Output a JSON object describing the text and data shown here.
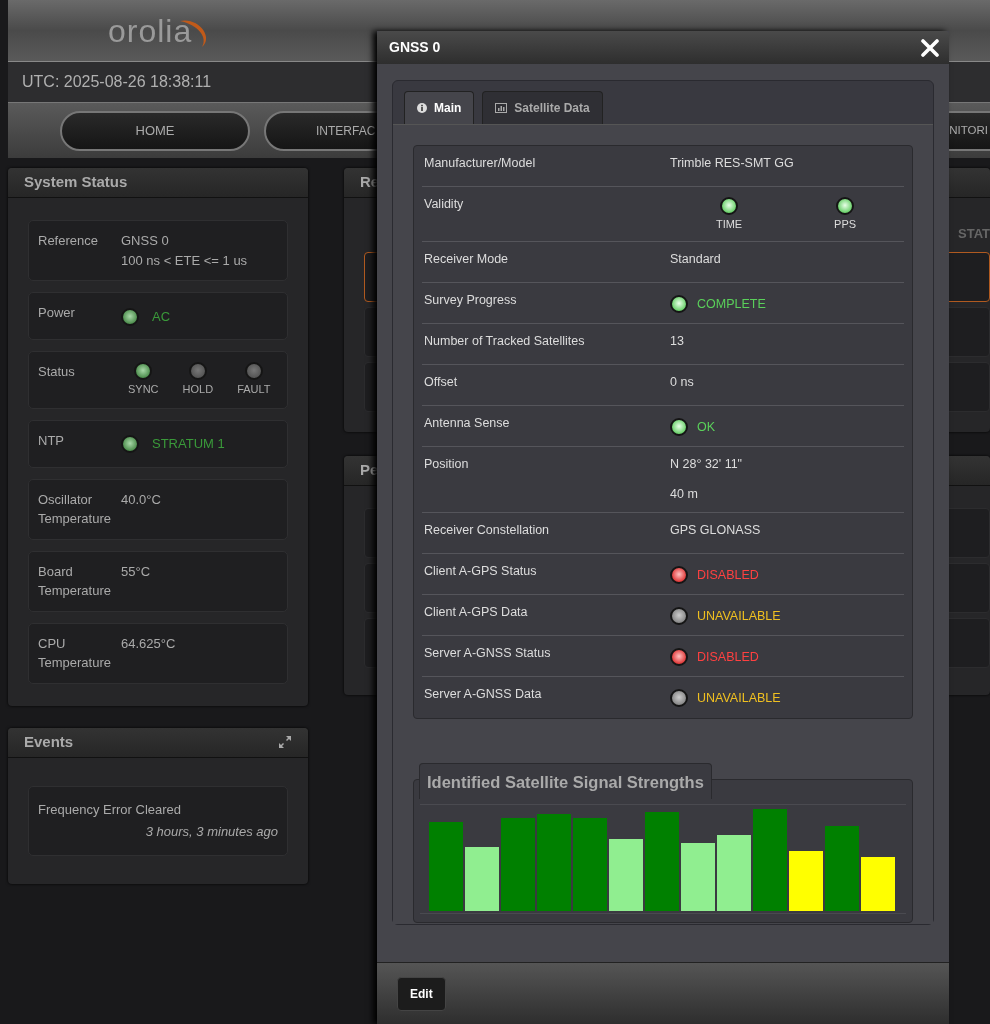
{
  "header": {
    "logo": "orolia",
    "clock": "UTC: 2025-08-26 18:38:11"
  },
  "nav": [
    {
      "label": "HOME"
    },
    {
      "label": "INTERFAC"
    },
    {
      "label": "NITORI"
    }
  ],
  "system_status": {
    "title": "System Status",
    "rows": [
      {
        "kind": "text",
        "label": "Reference",
        "lines": [
          "GNSS 0",
          "100 ns < ETE <= 1 us"
        ]
      },
      {
        "kind": "led",
        "label": "Power",
        "lit": true,
        "value": "AC"
      },
      {
        "kind": "leds",
        "label": "Status",
        "leds": [
          {
            "label": "SYNC",
            "lit": true
          },
          {
            "label": "HOLD",
            "lit": false
          },
          {
            "label": "FAULT",
            "lit": false
          }
        ]
      },
      {
        "kind": "led",
        "label": "NTP",
        "lit": true,
        "value": "STRATUM 1"
      },
      {
        "kind": "text",
        "label": "Oscillator Temperature",
        "lines": [
          "40.0°C"
        ]
      },
      {
        "kind": "text",
        "label": "Board Temperature",
        "lines": [
          "55°C"
        ]
      },
      {
        "kind": "text",
        "label": "CPU Temperature",
        "lines": [
          "64.625°C"
        ]
      }
    ]
  },
  "events": {
    "title": "Events",
    "items": [
      {
        "text": "Frequency Error Cleared",
        "time": "3 hours, 3 minutes ago"
      }
    ]
  },
  "reference_panel": {
    "title": "Re",
    "column": "STAT",
    "rows": [
      {
        "selected": true
      },
      {
        "selected": false
      },
      {
        "selected": false
      }
    ]
  },
  "performance_panel": {
    "title": "Pe"
  },
  "modal": {
    "title": "GNSS 0",
    "tabs": [
      {
        "label": "Main",
        "selected": true
      },
      {
        "label": "Satellite Data",
        "selected": false
      }
    ],
    "rows": [
      {
        "kind": "text",
        "label": "Manufacturer/Model",
        "lines": [
          "Trimble RES-SMT GG"
        ]
      },
      {
        "kind": "leds",
        "label": "Validity",
        "leds": [
          {
            "label": "TIME",
            "lit": true
          },
          {
            "label": "PPS",
            "lit": true
          }
        ]
      },
      {
        "kind": "text",
        "label": "Receiver Mode",
        "lines": [
          "Standard"
        ]
      },
      {
        "kind": "ok",
        "label": "Survey Progress",
        "value": "COMPLETE"
      },
      {
        "kind": "text",
        "label": "Number of Tracked Satellites",
        "lines": [
          "13"
        ]
      },
      {
        "kind": "text",
        "label": "Offset",
        "lines": [
          "0 ns"
        ]
      },
      {
        "kind": "ok",
        "label": "Antenna Sense",
        "value": "OK"
      },
      {
        "kind": "text",
        "label": "Position",
        "lines": [
          "N 28° 32' 11\"",
          "40 m"
        ]
      },
      {
        "kind": "text",
        "label": "Receiver Constellation",
        "lines": [
          "GPS GLONASS"
        ]
      },
      {
        "kind": "error",
        "label": "Client A-GPS Status",
        "value": "DISABLED"
      },
      {
        "kind": "unavailable",
        "label": "Client A-GPS Data",
        "value": "UNAVAILABLE"
      },
      {
        "kind": "error",
        "label": "Server A-GNSS Status",
        "value": "DISABLED"
      },
      {
        "kind": "unavailable",
        "label": "Server A-GNSS Data",
        "value": "UNAVAILABLE"
      }
    ],
    "chart": {
      "title": "Identified Satellite Signal Strengths",
      "bars": [
        {
          "color": "#008000"
        },
        {
          "color": "#90ee90"
        },
        {
          "color": "#008000"
        },
        {
          "color": "#008000"
        },
        {
          "color": "#008000"
        },
        {
          "color": "#90ee90"
        },
        {
          "color": "#008000"
        },
        {
          "color": "#90ee90"
        },
        {
          "color": "#90ee90"
        },
        {
          "color": "#008000"
        },
        {
          "color": "#ffff00"
        },
        {
          "color": "#008000"
        },
        {
          "color": "#ffff00"
        }
      ]
    },
    "footer_button": "Edit"
  }
}
